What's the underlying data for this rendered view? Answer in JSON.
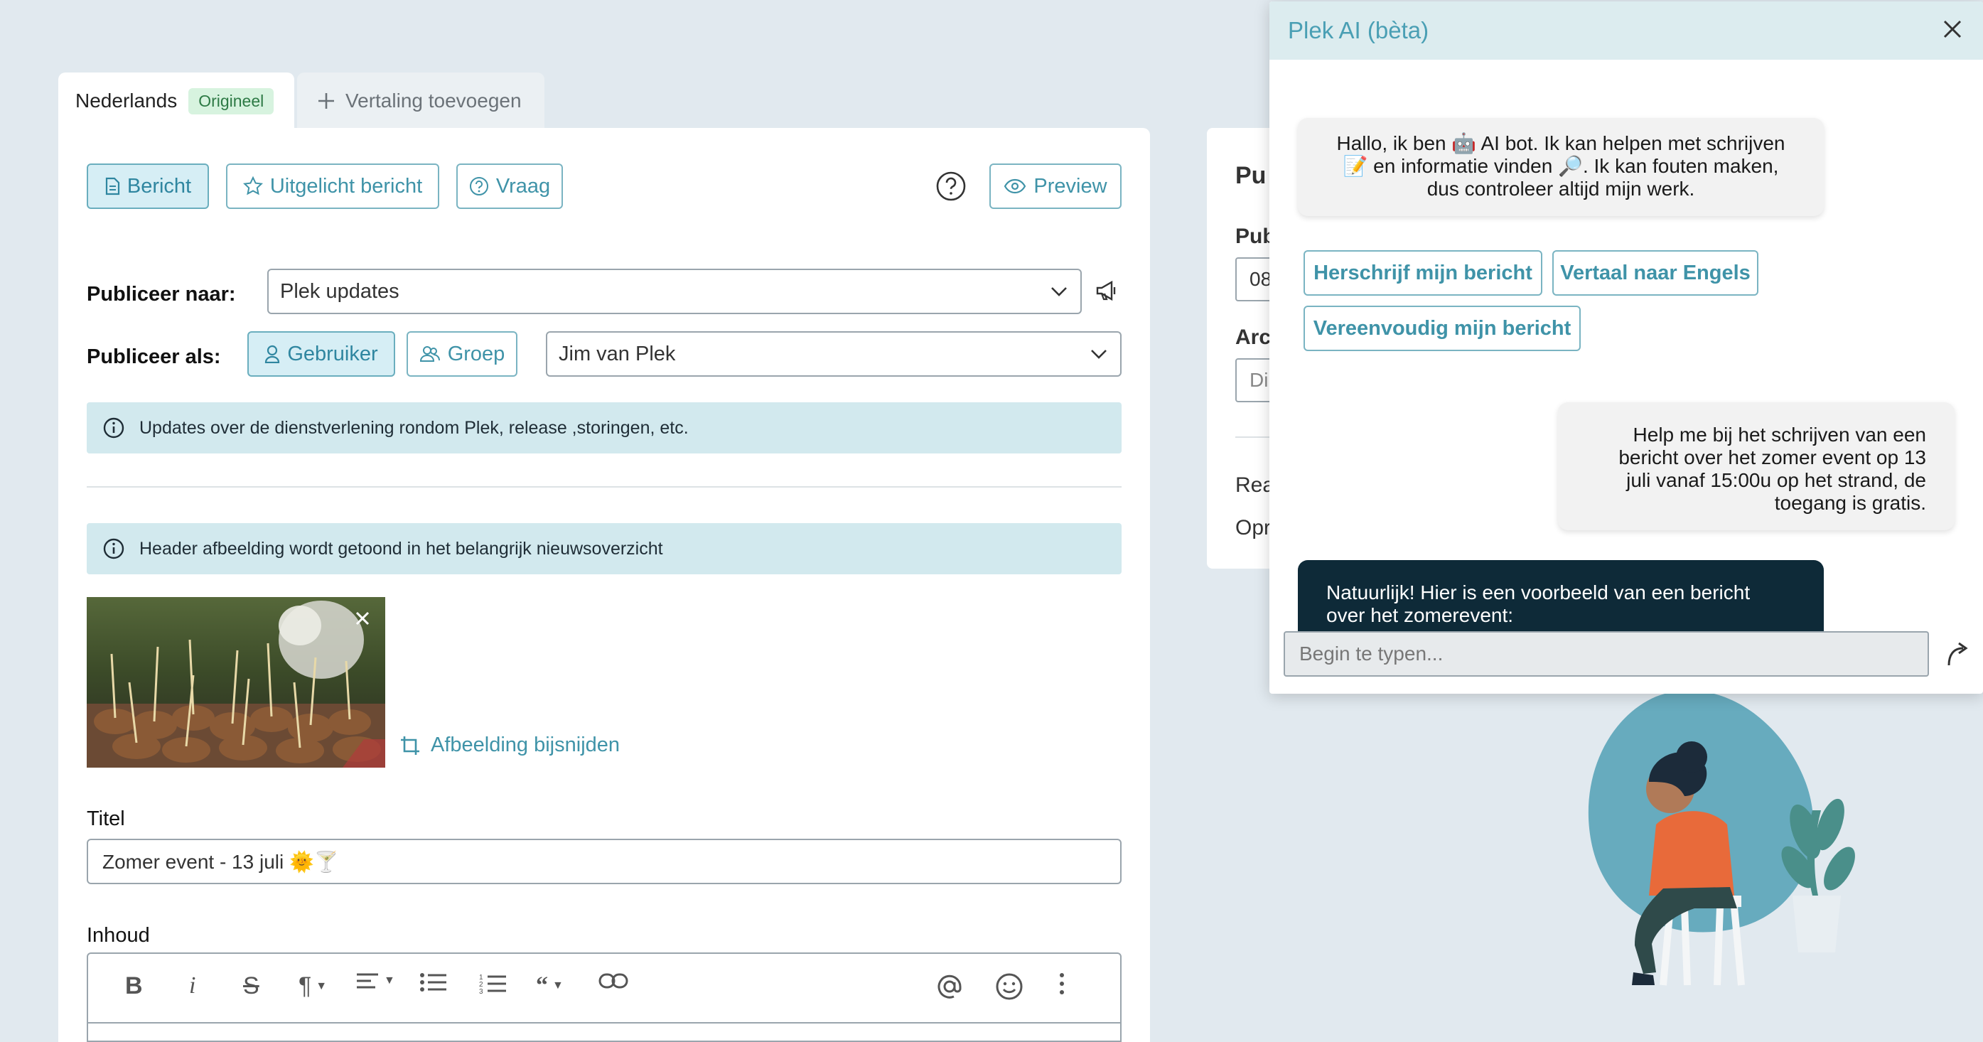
{
  "tabs": {
    "active_label": "Nederlands",
    "active_badge": "Origineel",
    "add_label": "Vertaling toevoegen"
  },
  "type_buttons": {
    "message": "Bericht",
    "featured": "Uitgelicht bericht",
    "question": "Vraag",
    "preview": "Preview"
  },
  "publish_to": {
    "label": "Publiceer naar:",
    "value": "Plek updates"
  },
  "publish_as": {
    "label": "Publiceer als:",
    "user_button": "Gebruiker",
    "group_button": "Groep",
    "value": "Jim van Plek"
  },
  "info": {
    "channel_description": "Updates over de dienstverlening rondom Plek, release ,storingen, etc.",
    "header_image_note": "Header afbeelding wordt getoond in het belangrijk nieuwsoverzicht"
  },
  "image": {
    "crop_label": "Afbeelding bijsnijden"
  },
  "title_field": {
    "label": "Titel",
    "value": "Zomer event - 13 juli 🌞🍸"
  },
  "content_field": {
    "label": "Inhoud"
  },
  "right_card": {
    "heading": "Pu",
    "field1_label": "Pub",
    "field1_value": "08",
    "field2_label": "Arc",
    "field2_value": "Di",
    "row1": "Rea",
    "row2": "Opr"
  },
  "chat": {
    "title": "Plek AI (bèta)",
    "bot_intro_1": "Hallo, ik ben 🤖 AI bot. Ik kan helpen met schrijven",
    "bot_intro_2": "📝 en informatie vinden 🔎. Ik kan fouten maken,",
    "bot_intro_3": "dus controleer altijd mijn werk.",
    "suggestions": [
      "Herschrijf mijn bericht",
      "Vertaal naar Engels",
      "Vereenvoudig mijn bericht"
    ],
    "user_msg_1": "Help me bij het schrijven van een",
    "user_msg_2": "bericht over het zomer event op 13",
    "user_msg_3": "juli vanaf 15:00u op het strand, de",
    "user_msg_4": "toegang is gratis.",
    "answer_1": "Natuurlijk! Hier is een voorbeeld van een bericht",
    "answer_2": "over het zomerevent:",
    "input_placeholder": "Begin te typen..."
  },
  "colors": {
    "accent": "#3f93a8",
    "background": "#e1e9ef",
    "info_bg": "#d2e9ee",
    "answer_bg": "#0e2a38",
    "arrow": "#e2452a"
  }
}
